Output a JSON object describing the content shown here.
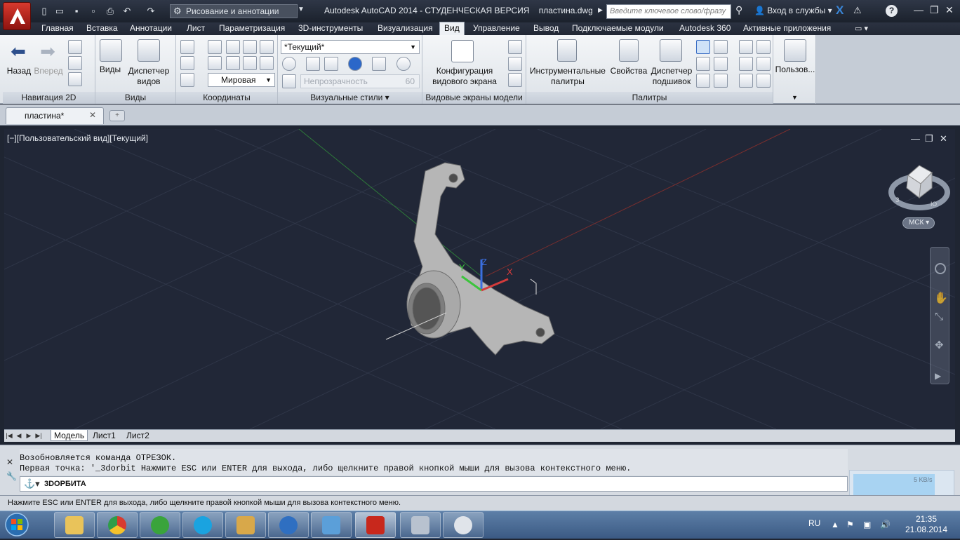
{
  "titlebar": {
    "workspace": "Рисование и аннотации",
    "app_title": "Autodesk AutoCAD 2014 - СТУДЕНЧЕСКАЯ ВЕРСИЯ    пластина.dwg",
    "search_placeholder": "Введите ключевое слово/фразу",
    "signin": "Вход в службы"
  },
  "ribbon_tabs": [
    "Главная",
    "Вставка",
    "Аннотации",
    "Лист",
    "Параметризация",
    "3D-инструменты",
    "Визуализация",
    "Вид",
    "Управление",
    "Вывод",
    "Подключаемые модули",
    "Autodesk 360",
    "Активные приложения"
  ],
  "ribbon": {
    "nav2d": {
      "back": "Назад",
      "forward": "Вперед",
      "title": "Навигация 2D"
    },
    "views": {
      "views": "Виды",
      "manager_line1": "Диспетчер",
      "manager_line2": "видов",
      "title": "Виды"
    },
    "coords": {
      "world": "Мировая",
      "title": "Координаты"
    },
    "visual": {
      "current": "*Текущий*",
      "opacity": "Непрозрачность",
      "opacity_value": "60",
      "title": "Визуальные стили"
    },
    "viewports": {
      "config_line1": "Конфигурация",
      "config_line2": "видового экрана",
      "title": "Видовые экраны модели"
    },
    "palettes": {
      "tool_line1": "Инструментальные",
      "tool_line2": "палитры",
      "props": "Свойства",
      "sheet_line1": "Диспетчер",
      "sheet_line2": "подшивок",
      "title": "Палитры"
    },
    "user": {
      "label": "Пользов..."
    }
  },
  "doc_tab": "пластина*",
  "viewport": {
    "label": "[−][Пользовательский вид][Текущий]",
    "ucs_label": "МСК",
    "axis_x": "X",
    "axis_y": "Y",
    "axis_z": "Z",
    "cube_compass": [
      "З",
      "Ю"
    ]
  },
  "layout_tabs": [
    "Модель",
    "Лист1",
    "Лист2"
  ],
  "command": {
    "history_1": "Возобновляется команда ОТРЕЗОК.",
    "history_2": "Первая точка: '_3dorbit Нажмите ESC или ENTER для выхода, либо щелкните правой кнопкой мыши для вызова контекстного меню.",
    "current": "3DОРБИТА"
  },
  "net_speed": "5 KB/s",
  "status": "Нажмите ESC или ENTER для выхода, либо щелкните правой кнопкой мыши для вызова контекстного меню.",
  "taskbar": {
    "lang": "RU",
    "time": "21:35",
    "date": "21.08.2014",
    "apps": [
      "explorer",
      "chrome",
      "utorrent",
      "skype",
      "downloads",
      "kompas",
      "photos",
      "autocad",
      "calculator",
      "paint"
    ]
  },
  "colors": {
    "accent_red": "#c8281c",
    "viewport_bg": "#212737",
    "axis_x": "#d43b3b",
    "axis_y": "#3cc43c",
    "axis_z": "#3b6fe0"
  }
}
